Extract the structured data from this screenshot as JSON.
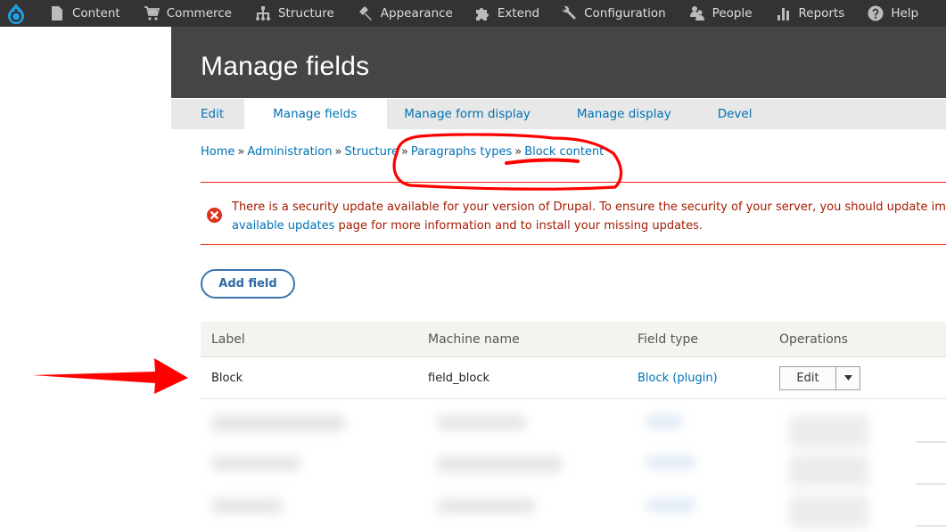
{
  "toolbar": {
    "logo": "drupal-logo",
    "items": [
      {
        "label": "Content",
        "icon": "file-icon"
      },
      {
        "label": "Commerce",
        "icon": "cart-icon"
      },
      {
        "label": "Structure",
        "icon": "sitemap-icon"
      },
      {
        "label": "Appearance",
        "icon": "paintbrush-icon"
      },
      {
        "label": "Extend",
        "icon": "puzzle-icon"
      },
      {
        "label": "Configuration",
        "icon": "wrench-icon"
      },
      {
        "label": "People",
        "icon": "people-icon"
      },
      {
        "label": "Reports",
        "icon": "bar-chart-icon"
      },
      {
        "label": "Help",
        "icon": "help-icon"
      }
    ]
  },
  "header": {
    "title": "Manage fields"
  },
  "tabs": [
    {
      "label": "Edit",
      "active": false
    },
    {
      "label": "Manage fields",
      "active": true
    },
    {
      "label": "Manage form display",
      "active": false
    },
    {
      "label": "Manage display",
      "active": false
    },
    {
      "label": "Devel",
      "active": false
    }
  ],
  "breadcrumb": {
    "separator": "»",
    "items": [
      "Home",
      "Administration",
      "Structure",
      "Paragraphs types",
      "Block content"
    ]
  },
  "message": {
    "type": "error",
    "icon": "error-x-icon",
    "line1": "There is a security update available for your version of Drupal. To ensure the security of your server, you should update immediately! See the",
    "link": "available updates",
    "line2_rest": " page for more information and to install your missing updates."
  },
  "actions": {
    "add_field": "Add field"
  },
  "table": {
    "columns": [
      "Label",
      "Machine name",
      "Field type",
      "Operations"
    ],
    "rows": [
      {
        "label": "Block",
        "machine_name": "field_block",
        "field_type": "Block (plugin)",
        "operation": "Edit"
      }
    ],
    "blurred_rows": 3
  },
  "colors": {
    "toolbar_bg": "#333333",
    "header_bg": "#454545",
    "link": "#0071b3",
    "error": "#e62600",
    "annotation": "#ff0000"
  }
}
